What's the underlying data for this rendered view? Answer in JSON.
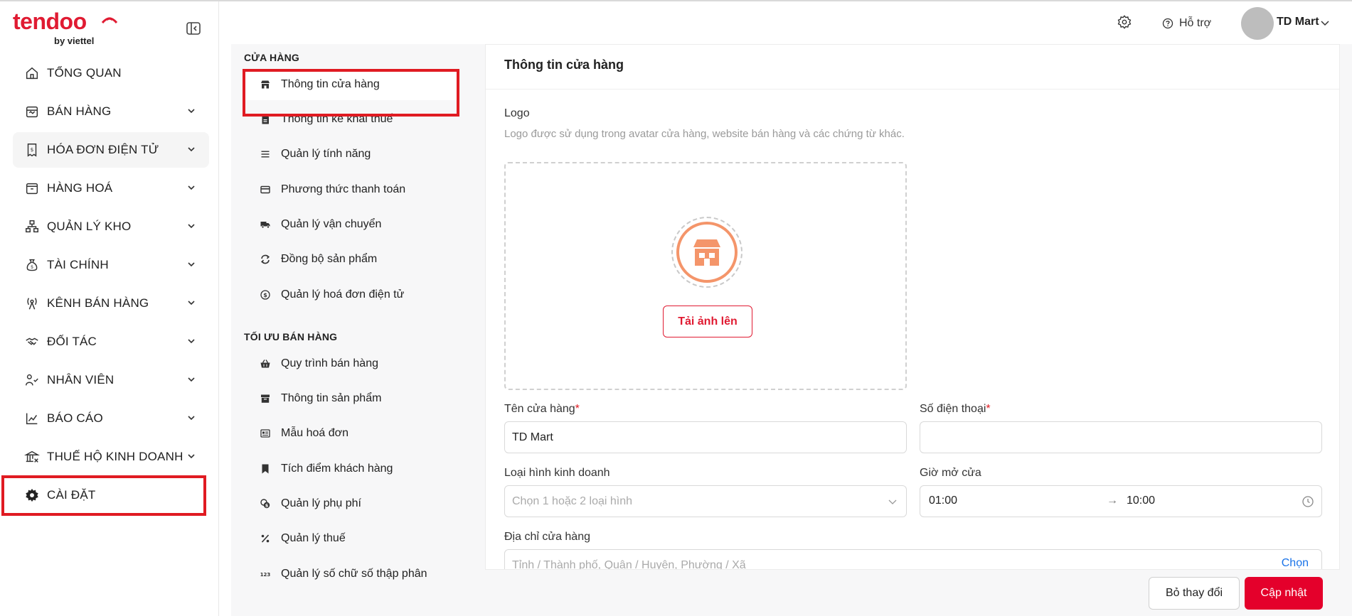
{
  "brand": {
    "name": "tendoo",
    "sub": "by viettel",
    "accent": "#e01b32"
  },
  "sidebar": {
    "items": [
      {
        "label": "TỔNG QUAN",
        "icon": "home-icon",
        "has_chevron": false
      },
      {
        "label": "BÁN HÀNG",
        "icon": "shop-icon",
        "has_chevron": true
      },
      {
        "label": "HÓA ĐƠN ĐIỆN TỬ",
        "icon": "invoice-icon",
        "has_chevron": true
      },
      {
        "label": "HÀNG HOÁ",
        "icon": "box-icon",
        "has_chevron": true
      },
      {
        "label": "QUẢN LÝ KHO",
        "icon": "warehouse-icon",
        "has_chevron": true
      },
      {
        "label": "TÀI CHÍNH",
        "icon": "money-bag-icon",
        "has_chevron": true
      },
      {
        "label": "KÊNH BÁN HÀNG",
        "icon": "broadcast-icon",
        "has_chevron": true
      },
      {
        "label": "ĐỐI TÁC",
        "icon": "handshake-icon",
        "has_chevron": true
      },
      {
        "label": "NHÂN VIÊN",
        "icon": "staff-icon",
        "has_chevron": true
      },
      {
        "label": "BÁO CÁO",
        "icon": "report-chart-icon",
        "has_chevron": true
      },
      {
        "label": "THUẾ HỘ KINH DOANH",
        "icon": "tax-building-icon",
        "has_chevron": true
      },
      {
        "label": "CÀI ĐẶT",
        "icon": "gear-icon",
        "has_chevron": false
      }
    ]
  },
  "header": {
    "help_label": "Hỗ trợ",
    "account_name": "TD Mart"
  },
  "subnav": {
    "section1": "CỬA HÀNG",
    "section2": "TỐI ƯU BÁN HÀNG",
    "items1": [
      {
        "label": "Thông tin cửa hàng",
        "icon": "store-icon"
      },
      {
        "label": "Thông tin kê khai thuế",
        "icon": "document-icon"
      },
      {
        "label": "Quản lý tính năng",
        "icon": "list-icon"
      },
      {
        "label": "Phương thức thanh toán",
        "icon": "card-icon"
      },
      {
        "label": "Quản lý vận chuyển",
        "icon": "truck-icon"
      },
      {
        "label": "Đồng bộ sản phẩm",
        "icon": "sync-icon"
      },
      {
        "label": "Quản lý hoá đơn điện tử",
        "icon": "dollar-circle-icon"
      }
    ],
    "items2": [
      {
        "label": "Quy trình bán hàng",
        "icon": "basket-icon"
      },
      {
        "label": "Thông tin sản phẩm",
        "icon": "archive-icon"
      },
      {
        "label": "Mẫu hoá đơn",
        "icon": "receipt-icon"
      },
      {
        "label": "Tích điểm khách hàng",
        "icon": "bookmark-icon"
      },
      {
        "label": "Quản lý phụ phí",
        "icon": "coins-icon"
      },
      {
        "label": "Quản lý thuế",
        "icon": "percent-icon"
      },
      {
        "label": "Quản lý số chữ số thập phân",
        "icon": "number-123-icon"
      }
    ]
  },
  "form": {
    "title": "Thông tin cửa hàng",
    "logo_label": "Logo",
    "logo_hint": "Logo được sử dụng trong avatar cửa hàng, website bán hàng và các chứng từ khác.",
    "upload_label": "Tải ảnh lên",
    "store_name_label": "Tên cửa hàng",
    "store_name_value": "TD Mart",
    "phone_label": "Số điện thoại",
    "phone_value": "",
    "business_type_label": "Loại hình kinh doanh",
    "business_type_placeholder": "Chọn 1 hoặc 2 loại hình",
    "opening_hours_label": "Giờ mở cửa",
    "open_from": "01:00",
    "open_to": "10:00",
    "time_separator": "→",
    "address_label": "Địa chỉ cửa hàng",
    "address_placeholder": "Tỉnh / Thành phố, Quận / Huyện, Phường / Xã",
    "address_choose": "Chọn",
    "required_mark": "*"
  },
  "footer": {
    "discard_label": "Bỏ thay đổi",
    "update_label": "Cập nhật"
  }
}
